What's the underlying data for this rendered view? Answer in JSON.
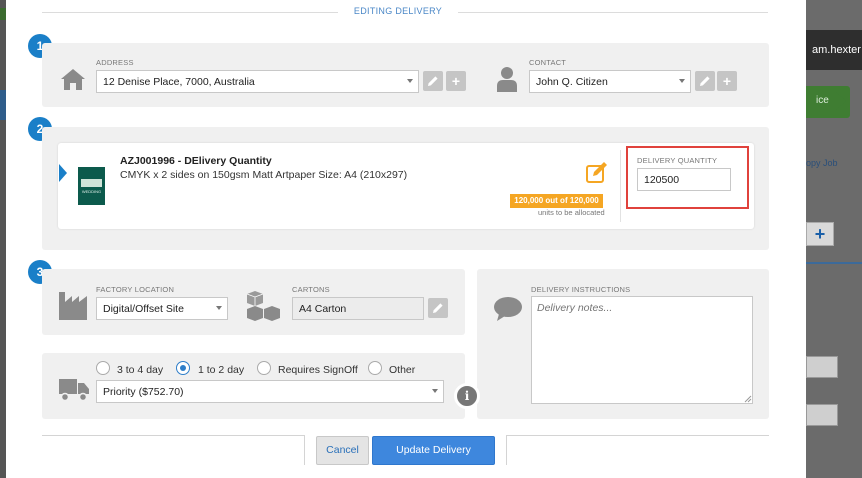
{
  "background": {
    "user_name": "am.hexter",
    "green_button_label": "ice",
    "copy_job_label": "opy Job",
    "plus_label": "+"
  },
  "header": {
    "title": "EDITING DELIVERY"
  },
  "steps": {
    "one": "1",
    "two": "2",
    "three": "3"
  },
  "address": {
    "label": "ADDRESS",
    "value": "12 Denise Place, 7000, Australia",
    "plus_label": "+"
  },
  "contact": {
    "label": "CONTACT",
    "value": "John Q. Citizen",
    "plus_label": "+"
  },
  "item": {
    "code_title": "AZJ001996 - DElivery Quantity",
    "description": "CMYK x 2 sides on 150gsm Matt Artpaper Size: A4 (210x297)",
    "allocation_badge": "120,000 out of 120,000",
    "allocation_sub": "units to be allocated",
    "thumbnail_caption": "WEDDING"
  },
  "delivery_quantity": {
    "label": "DELIVERY QUANTITY",
    "value": "120500",
    "highlight_color": "#e0423c"
  },
  "factory": {
    "label": "FACTORY LOCATION",
    "value": "Digital/Offset Site"
  },
  "cartons": {
    "label": "CARTONS",
    "value": "A4 Carton"
  },
  "delivery_instructions": {
    "label": "DELIVERY INSTRUCTIONS",
    "placeholder": "Delivery notes..."
  },
  "shipping": {
    "options": [
      {
        "label": "3 to 4 day",
        "selected": false
      },
      {
        "label": "1 to 2 day",
        "selected": true
      },
      {
        "label": "Requires SignOff",
        "selected": false
      },
      {
        "label": "Other",
        "selected": false
      }
    ],
    "service_value": "Priority ($752.70)",
    "info_icon_glyph": "i"
  },
  "footer": {
    "cancel_label": "Cancel",
    "update_label": "Update Delivery"
  },
  "colors": {
    "accent": "#1a7fc8",
    "primary_button": "#3e87dd",
    "badge": "#f5a623"
  }
}
